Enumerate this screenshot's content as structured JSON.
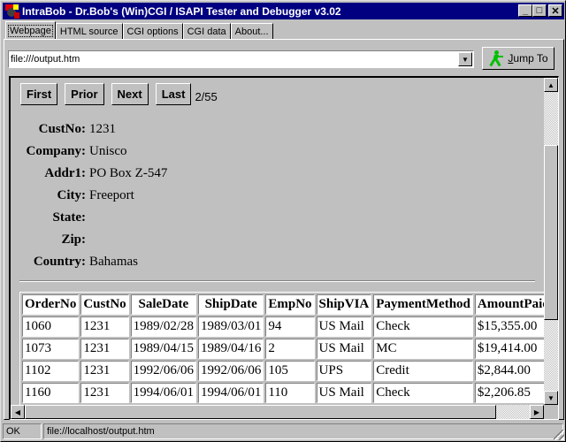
{
  "window": {
    "title": "IntraBob - Dr.Bob's (Win)CGI / ISAPI Tester and Debugger v3.02",
    "controls": {
      "minimize": "_",
      "maximize": "□",
      "close": "✕"
    }
  },
  "tabs": [
    {
      "label": "Webpage",
      "active": true
    },
    {
      "label": "HTML source",
      "active": false
    },
    {
      "label": "CGI options",
      "active": false
    },
    {
      "label": "CGI data",
      "active": false
    },
    {
      "label": "About...",
      "active": false
    }
  ],
  "toolbar": {
    "url_value": "file:///output.htm",
    "dropdown_icon": "▼",
    "jump_label_prefix": "J",
    "jump_label_rest": "ump To"
  },
  "page": {
    "nav": {
      "first": "First",
      "prior": "Prior",
      "next": "Next",
      "last": "Last",
      "counter": "2/55"
    },
    "fields": [
      {
        "label": "CustNo:",
        "value": "1231"
      },
      {
        "label": "Company:",
        "value": "Unisco"
      },
      {
        "label": "Addr1:",
        "value": "PO Box Z-547"
      },
      {
        "label": "City:",
        "value": "Freeport"
      },
      {
        "label": "State:",
        "value": ""
      },
      {
        "label": "Zip:",
        "value": ""
      },
      {
        "label": "Country:",
        "value": "Bahamas"
      }
    ],
    "orders": {
      "columns": [
        "OrderNo",
        "CustNo",
        "SaleDate",
        "ShipDate",
        "EmpNo",
        "ShipVIA",
        "PaymentMethod",
        "AmountPaid"
      ],
      "rows": [
        [
          "1060",
          "1231",
          "1989/02/28",
          "1989/03/01",
          "94",
          "US Mail",
          "Check",
          "$15,355.00"
        ],
        [
          "1073",
          "1231",
          "1989/04/15",
          "1989/04/16",
          "2",
          "US Mail",
          "MC",
          "$19,414.00"
        ],
        [
          "1102",
          "1231",
          "1992/06/06",
          "1992/06/06",
          "105",
          "UPS",
          "Credit",
          "$2,844.00"
        ],
        [
          "1160",
          "1231",
          "1994/06/01",
          "1994/06/01",
          "110",
          "US Mail",
          "Check",
          "$2,206.85"
        ]
      ]
    }
  },
  "scroll": {
    "up": "▲",
    "down": "▼",
    "left": "◀",
    "right": "▶"
  },
  "status": {
    "state": "OK",
    "url": "file://localhost/output.htm"
  }
}
